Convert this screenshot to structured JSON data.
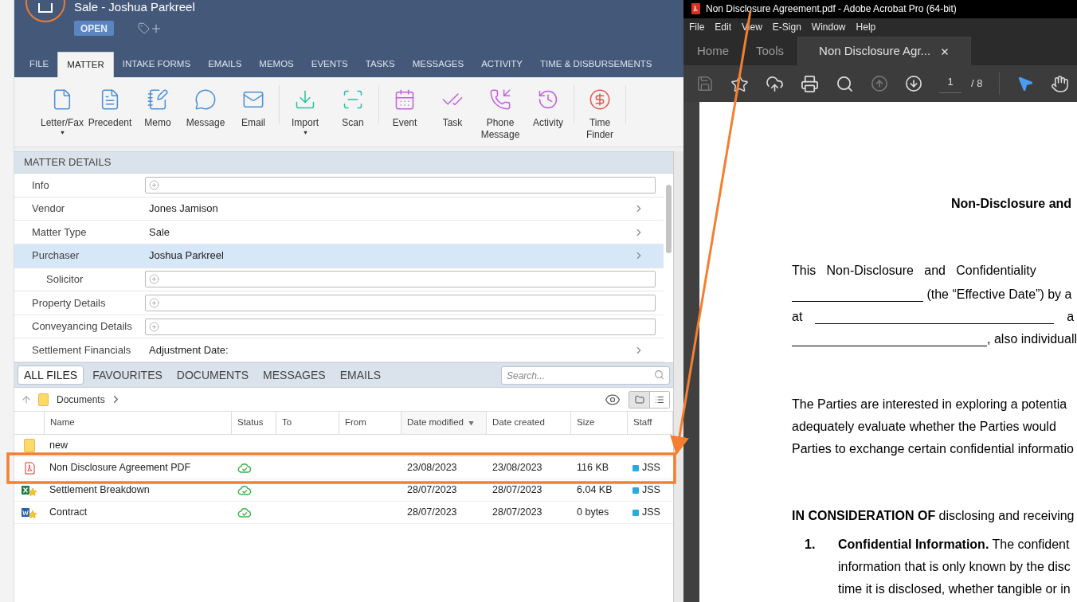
{
  "matter_header": {
    "title": "Sale - Joshua Parkreel",
    "status_badge": "OPEN"
  },
  "tabs": [
    {
      "label": "FILE",
      "selected": false
    },
    {
      "label": "MATTER",
      "selected": true
    },
    {
      "label": "INTAKE FORMS",
      "selected": false
    },
    {
      "label": "EMAILS",
      "selected": false
    },
    {
      "label": "MEMOS",
      "selected": false
    },
    {
      "label": "EVENTS",
      "selected": false
    },
    {
      "label": "TASKS",
      "selected": false
    },
    {
      "label": "MESSAGES",
      "selected": false
    },
    {
      "label": "ACTIVITY",
      "selected": false
    },
    {
      "label": "TIME & DISBURSEMENTS",
      "selected": false
    }
  ],
  "ribbon_groups": [
    [
      {
        "kind": "letter",
        "label": "Letter/Fax",
        "dropdown": true
      },
      {
        "kind": "precedent",
        "label": "Precedent",
        "dropdown": false
      },
      {
        "kind": "memo",
        "label": "Memo",
        "dropdown": false
      },
      {
        "kind": "message",
        "label": "Message",
        "dropdown": false
      },
      {
        "kind": "email",
        "label": "Email",
        "dropdown": false
      }
    ],
    [
      {
        "kind": "import",
        "label": "Import",
        "dropdown": true
      },
      {
        "kind": "scan",
        "label": "Scan",
        "dropdown": false
      }
    ],
    [
      {
        "kind": "event",
        "label": "Event",
        "dropdown": false
      },
      {
        "kind": "task",
        "label": "Task",
        "dropdown": false
      },
      {
        "kind": "phone",
        "label": "Phone Message",
        "dropdown": false
      },
      {
        "kind": "activity",
        "label": "Activity",
        "dropdown": false
      }
    ],
    [
      {
        "kind": "time",
        "label": "Time Finder",
        "dropdown": false
      }
    ]
  ],
  "matter_details": {
    "title": "MATTER DETAILS",
    "rows": [
      {
        "label": "Info",
        "kind": "add",
        "selected": false
      },
      {
        "label": "Vendor",
        "kind": "link",
        "value": "Jones Jamison",
        "selected": false
      },
      {
        "label": "Matter Type",
        "kind": "link",
        "value": "Sale",
        "selected": false
      },
      {
        "label": "Purchaser",
        "kind": "link",
        "value": "Joshua Parkreel",
        "selected": true,
        "children": [
          {
            "label": "Solicitor",
            "kind": "add",
            "selected": false
          }
        ]
      },
      {
        "label": "Property Details",
        "kind": "add",
        "selected": false
      },
      {
        "label": "Conveyancing Details",
        "kind": "add",
        "selected": false
      },
      {
        "label": "Settlement Financials",
        "kind": "link",
        "value": "Adjustment Date:",
        "selected": false
      }
    ]
  },
  "files": {
    "tabs": [
      {
        "label": "ALL FILES",
        "selected": true
      },
      {
        "label": "FAVOURITES",
        "selected": false
      },
      {
        "label": "DOCUMENTS",
        "selected": false
      },
      {
        "label": "MESSAGES",
        "selected": false
      },
      {
        "label": "EMAILS",
        "selected": false
      }
    ],
    "search": {
      "placeholder": "Search..."
    },
    "breadcrumb": "Documents",
    "view_modes": [
      {
        "kind": "folder",
        "selected": true
      },
      {
        "kind": "list",
        "selected": false
      }
    ],
    "columns": [
      {
        "label": "Name",
        "sorted": false
      },
      {
        "label": "Status",
        "sorted": false
      },
      {
        "label": "To",
        "sorted": false
      },
      {
        "label": "From",
        "sorted": false
      },
      {
        "label": "Date modified",
        "sorted": true
      },
      {
        "label": "Date created",
        "sorted": false
      },
      {
        "label": "Size",
        "sorted": false
      },
      {
        "label": "Staff",
        "sorted": false
      }
    ],
    "rows": [
      {
        "kind": "folder",
        "name": "new"
      },
      {
        "kind": "pdf",
        "name": "Non Disclosure Agreement PDF",
        "synced": true,
        "date_modified": "23/08/2023",
        "date_created": "23/08/2023",
        "size": "116 KB",
        "staff": "JSS",
        "color": "#29aae1"
      },
      {
        "kind": "excel",
        "name": "Settlement Breakdown",
        "synced": true,
        "date_modified": "28/07/2023",
        "date_created": "28/07/2023",
        "size": "6.04 KB",
        "staff": "JSS",
        "color": "#29aae1"
      },
      {
        "kind": "word",
        "name": "Contract",
        "synced": true,
        "date_modified": "28/07/2023",
        "date_created": "28/07/2023",
        "size": "0 bytes",
        "staff": "JSS",
        "color": "#29aae1"
      }
    ]
  },
  "acrobat": {
    "title": "Non Disclosure Agreement.pdf - Adobe Acrobat Pro (64-bit)",
    "menu": [
      "File",
      "Edit",
      "View",
      "E-Sign",
      "Window",
      "Help"
    ],
    "tabs": [
      {
        "label": "Home",
        "selected": false,
        "closable": false
      },
      {
        "label": "Tools",
        "selected": false,
        "closable": false
      },
      {
        "label": "Non Disclosure Agr...",
        "selected": true,
        "closable": true
      }
    ],
    "page": "1",
    "page_total": "/ 8",
    "document": [
      {
        "kind": "title",
        "text": "Non-Disclosure and"
      },
      {
        "kind": "gap"
      },
      {
        "kind": "line",
        "text": "This   Non-Disclosure   and   Confidentiality"
      },
      {
        "kind": "blank_before",
        "text": " (the “Effective Date”) by a"
      },
      {
        "kind": "blank_between",
        "before": "at",
        "after": "a"
      },
      {
        "kind": "blank_before",
        "text": ", also individuall"
      },
      {
        "kind": "gap"
      },
      {
        "kind": "line",
        "text": "The Parties are interested in exploring a potentia"
      },
      {
        "kind": "line",
        "text": "adequately evaluate whether the Parties would"
      },
      {
        "kind": "line",
        "text": "Parties to exchange certain confidential informatio"
      },
      {
        "kind": "gap"
      },
      {
        "kind": "line",
        "text": "**IN CONSIDERATION OF** disclosing and receiving"
      },
      {
        "kind": "item",
        "number": "1.",
        "lines": [
          "**Confidential Information.** The confident",
          "information that is only known by the disc",
          "time it is disclosed, whether tangible or in"
        ]
      }
    ]
  }
}
